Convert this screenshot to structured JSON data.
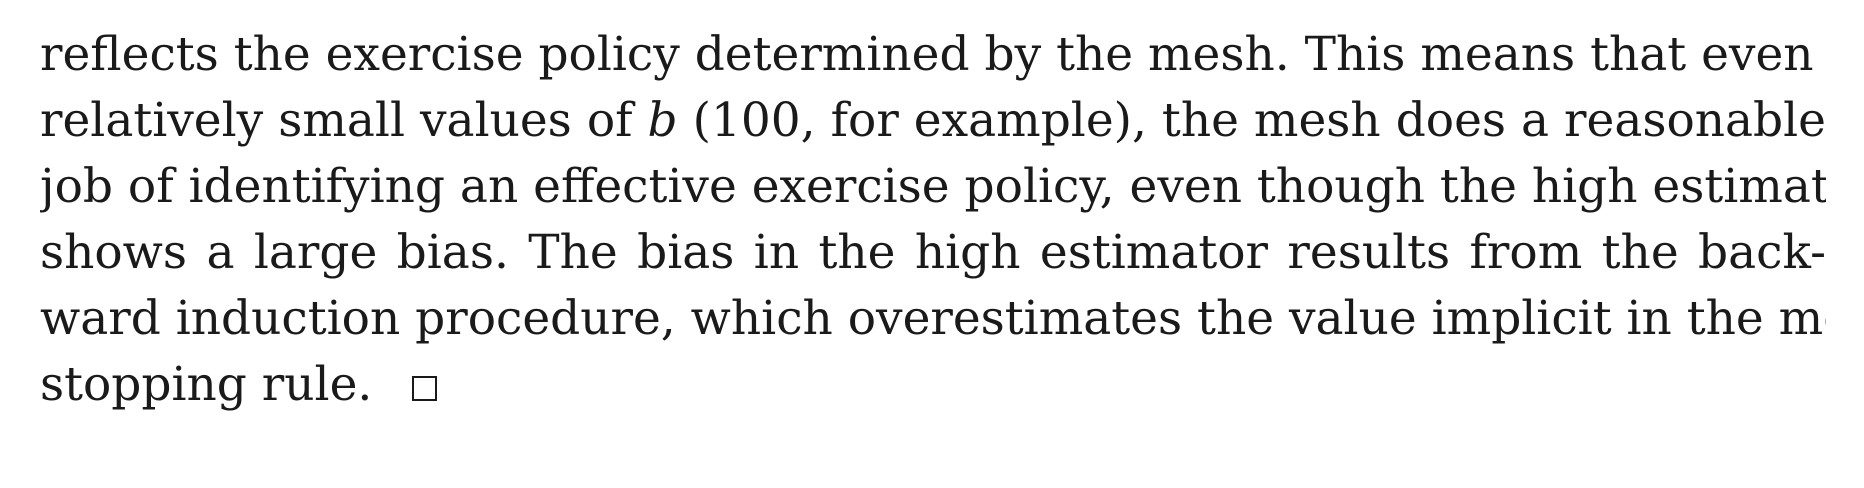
{
  "paragraph": {
    "lines": [
      "reflects the exercise policy determined by the mesh. This means that even at",
      "relatively small values of b (100, for example), the mesh does a reasonable",
      "job of identifying an effective exercise policy, even though the high estimator",
      "shows a large bias. The bias in the high estimator results from the back-",
      "ward induction procedure, which overestimates the value implicit in the mesh",
      "stopping rule."
    ],
    "end_symbol": "qed-square"
  }
}
